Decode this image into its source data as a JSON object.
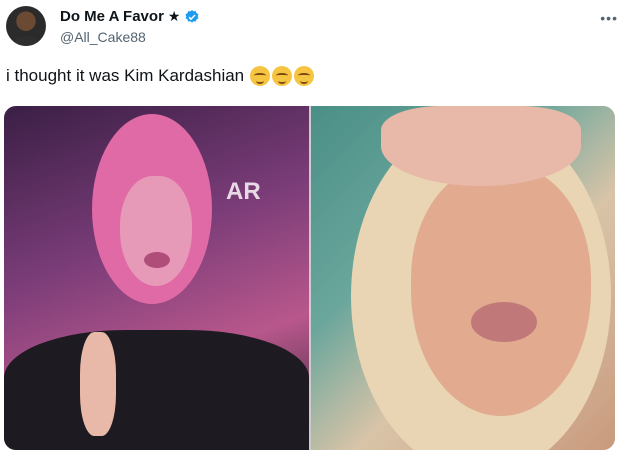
{
  "user": {
    "display_name": "Do Me A Favor",
    "star": "★",
    "handle": "@All_Cake88"
  },
  "more": "•••",
  "tweet": {
    "text": "i thought it was Kim Kardashian"
  },
  "media": {
    "left_sign_text": "AR"
  },
  "icons": {
    "verified": "verified-badge-icon",
    "emoji": "relieved-face-emoji"
  },
  "colors": {
    "verified_blue": "#1d9bf0",
    "handle_gray": "#536471"
  }
}
